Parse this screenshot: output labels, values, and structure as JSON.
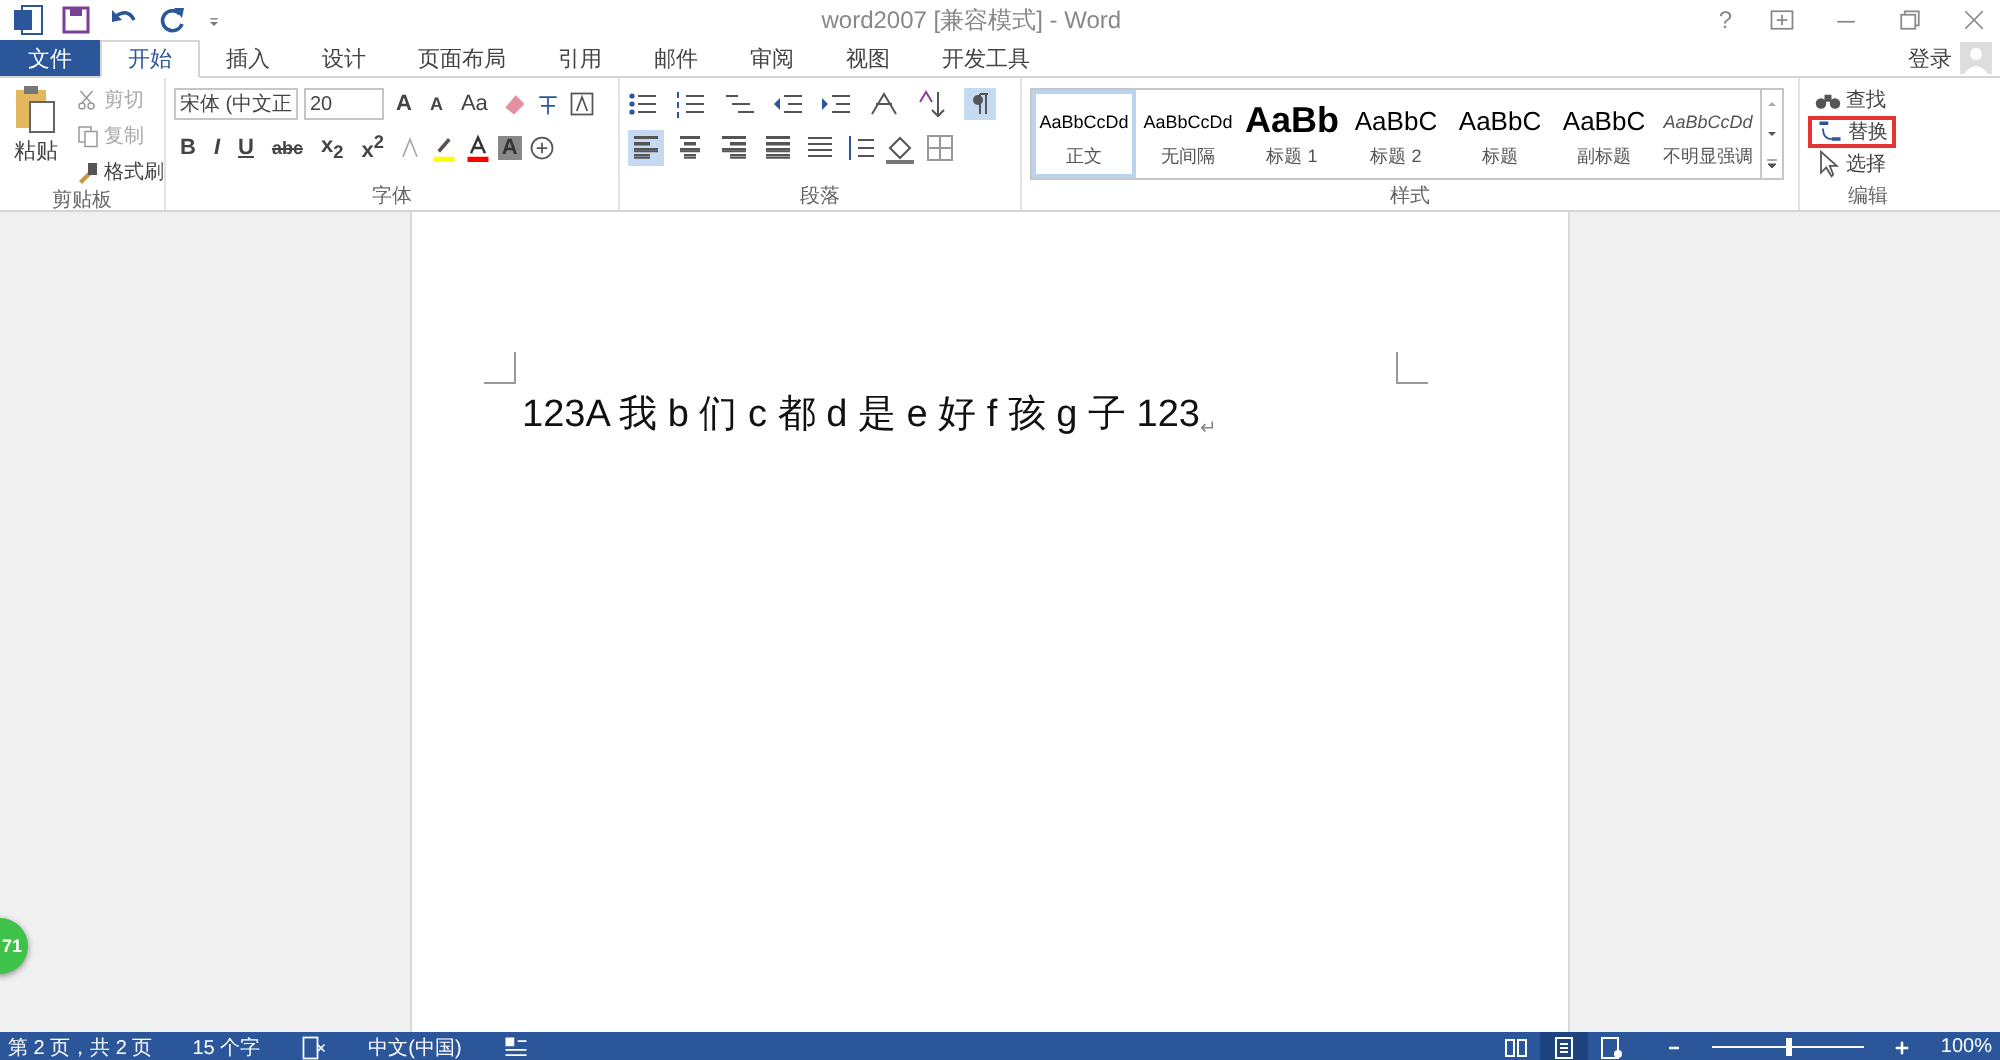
{
  "title_bar": {
    "title": "word2007 [兼容模式] - Word",
    "help": "?"
  },
  "tabs": [
    {
      "label": "文件",
      "kind": "file",
      "selected": false
    },
    {
      "label": "开始",
      "kind": "tab",
      "selected": true
    },
    {
      "label": "插入",
      "kind": "tab",
      "selected": false
    },
    {
      "label": "设计",
      "kind": "tab",
      "selected": false
    },
    {
      "label": "页面布局",
      "kind": "tab",
      "selected": false
    },
    {
      "label": "引用",
      "kind": "tab",
      "selected": false
    },
    {
      "label": "邮件",
      "kind": "tab",
      "selected": false
    },
    {
      "label": "审阅",
      "kind": "tab",
      "selected": false
    },
    {
      "label": "视图",
      "kind": "tab",
      "selected": false
    },
    {
      "label": "开发工具",
      "kind": "tab",
      "selected": false
    }
  ],
  "sign_in": "登录",
  "clipboard": {
    "label": "剪贴板",
    "paste": "粘贴",
    "items": [
      {
        "label": "剪切",
        "disabled": true
      },
      {
        "label": "复制",
        "disabled": true
      },
      {
        "label": "格式刷",
        "disabled": false
      }
    ]
  },
  "font": {
    "label": "字体",
    "font_name": "宋体 (中文正",
    "font_size": "20",
    "change_case": "Aa",
    "styles": [
      "B",
      "I",
      "U",
      "abc",
      "x$_{2}$",
      "x$^{2}$"
    ],
    "grow": "A",
    "shrink": "A",
    "shading": "A"
  },
  "paragraph": {
    "label": "段落",
    "alignment": [
      {
        "selected": true
      },
      {
        "selected": false
      },
      {
        "selected": false
      },
      {
        "selected": false
      }
    ],
    "show_marks": true
  },
  "styles": {
    "label": "样式",
    "items": [
      {
        "preview": "AaBbCcDd",
        "name": "正文",
        "kind": "normal",
        "selected": true
      },
      {
        "preview": "AaBbCcDd",
        "name": "无间隔",
        "kind": "normal",
        "selected": false
      },
      {
        "preview": "AaBb",
        "name": "标题 1",
        "kind": "heading1",
        "selected": false
      },
      {
        "preview": "AaBbC",
        "name": "标题 2",
        "kind": "heading2",
        "selected": false
      },
      {
        "preview": "AaBbC",
        "name": "标题",
        "kind": "title",
        "selected": false
      },
      {
        "preview": "AaBbC",
        "name": "副标题",
        "kind": "title",
        "selected": false
      },
      {
        "preview": "AaBbCcDd",
        "name": "不明显强调",
        "kind": "emphasis",
        "selected": false
      }
    ]
  },
  "editing": {
    "label": "编辑",
    "items": [
      {
        "label": "查找",
        "kind": "find",
        "highlighted": false
      },
      {
        "label": "替换",
        "kind": "replace",
        "highlighted": true
      },
      {
        "label": "选择",
        "kind": "select",
        "highlighted": false
      }
    ]
  },
  "document": {
    "text": "123A 我 b 们 c 都 d 是 e 好 f 孩 g 子 123",
    "paragraph_mark": "↵"
  },
  "floating_badge": "71",
  "status_bar": {
    "page": "第 2 页，共 2 页",
    "words": "15 个字",
    "language": "中文(中国)",
    "views": [
      {
        "selected": false
      },
      {
        "selected": true
      },
      {
        "selected": false
      }
    ],
    "zoom": {
      "level": 0.5,
      "label": "100%"
    }
  }
}
